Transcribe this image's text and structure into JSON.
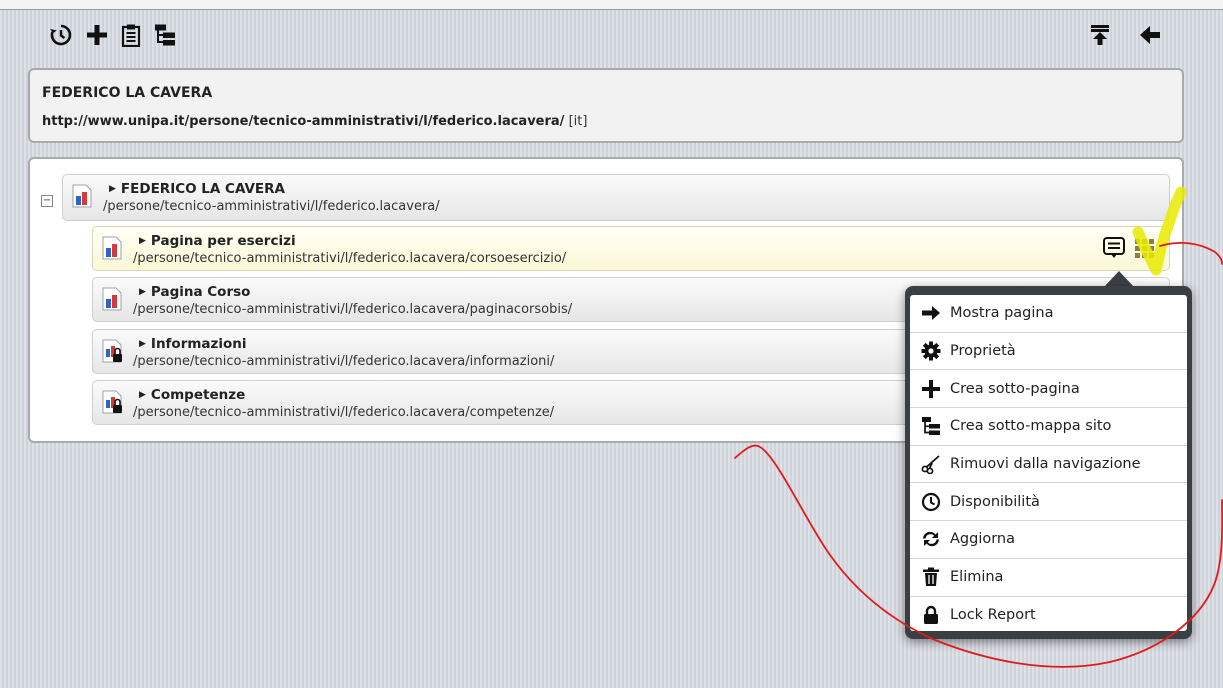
{
  "header": {
    "title": "FEDERICO LA CAVERA",
    "url": "http://www.unipa.it/persone/tecnico-amministrativi/l/federico.lacavera/",
    "lang": "[it]"
  },
  "toolbar": {
    "icons": [
      "history-icon",
      "add-icon",
      "clipboard-icon",
      "sitemap-icon",
      "collapse-up-icon",
      "back-arrow-icon"
    ]
  },
  "tree": {
    "collapse_symbol": "−",
    "root": {
      "title": "FEDERICO LA CAVERA",
      "path": "/persone/tecnico-amministrativi/l/federico.lacavera/"
    },
    "children": [
      {
        "title": "Pagina per esercizi",
        "path": "/persone/tecnico-amministrativi/l/federico.lacavera/corsoesercizio/"
      },
      {
        "title": "Pagina Corso",
        "path": "/persone/tecnico-amministrativi/l/federico.lacavera/paginacorsobis/"
      },
      {
        "title": "Informazioni",
        "path": "/persone/tecnico-amministrativi/l/federico.lacavera/informazioni/"
      },
      {
        "title": "Competenze",
        "path": "/persone/tecnico-amministrativi/l/federico.lacavera/competenze/"
      }
    ]
  },
  "context_menu": {
    "items": [
      {
        "label": "Mostra pagina",
        "icon": "arrow-right-icon"
      },
      {
        "label": "Proprietà",
        "icon": "gear-icon"
      },
      {
        "label": "Crea sotto-pagina",
        "icon": "plus-icon"
      },
      {
        "label": "Crea sotto-mappa sito",
        "icon": "sitemap-icon"
      },
      {
        "label": "Rimuovi dalla navigazione",
        "icon": "scissors-icon"
      },
      {
        "label": "Disponibilità",
        "icon": "clock-icon"
      },
      {
        "label": "Aggiorna",
        "icon": "refresh-icon"
      },
      {
        "label": "Elimina",
        "icon": "trash-icon"
      },
      {
        "label": "Lock Report",
        "icon": "lock-icon"
      }
    ]
  },
  "colors": {
    "highlight_row": "#fbf8d6",
    "menu_frame": "#3b3f44",
    "annotation_red": "#e01b1b",
    "annotation_yellow": "#e8ea00"
  }
}
